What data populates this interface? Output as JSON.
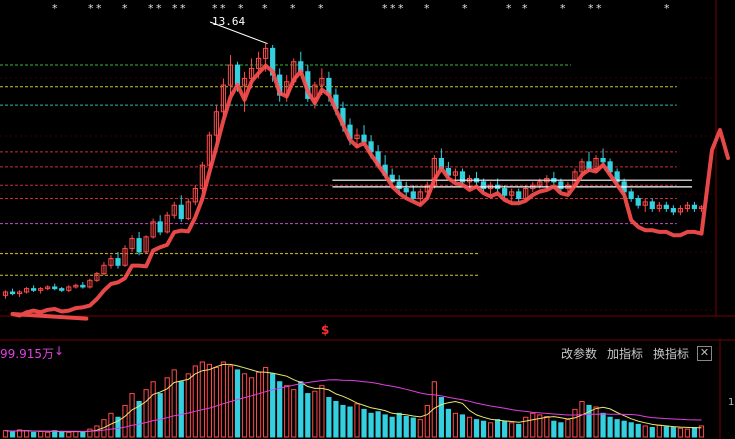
{
  "chart_data": {
    "type": "candlestick",
    "peak_label": "13.64",
    "price_range": [
      5.6,
      14.5
    ],
    "candles": [
      [
        6.1,
        6.25,
        6.0,
        6.2
      ],
      [
        6.2,
        6.3,
        6.1,
        6.15
      ],
      [
        6.15,
        6.25,
        6.05,
        6.2
      ],
      [
        6.2,
        6.35,
        6.15,
        6.3
      ],
      [
        6.3,
        6.4,
        6.2,
        6.25
      ],
      [
        6.25,
        6.35,
        6.15,
        6.3
      ],
      [
        6.3,
        6.4,
        6.25,
        6.35
      ],
      [
        6.35,
        6.45,
        6.25,
        6.3
      ],
      [
        6.3,
        6.35,
        6.2,
        6.25
      ],
      [
        6.25,
        6.4,
        6.2,
        6.35
      ],
      [
        6.35,
        6.45,
        6.3,
        6.4
      ],
      [
        6.4,
        6.5,
        6.3,
        6.35
      ],
      [
        6.35,
        6.6,
        6.3,
        6.55
      ],
      [
        6.55,
        6.8,
        6.5,
        6.75
      ],
      [
        6.75,
        7.1,
        6.7,
        7.0
      ],
      [
        7.0,
        7.3,
        6.9,
        7.2
      ],
      [
        7.2,
        7.4,
        6.9,
        7.0
      ],
      [
        7.0,
        7.6,
        6.95,
        7.5
      ],
      [
        7.5,
        7.9,
        7.4,
        7.8
      ],
      [
        7.8,
        8.0,
        7.3,
        7.4
      ],
      [
        7.4,
        7.9,
        7.35,
        7.85
      ],
      [
        7.85,
        8.4,
        7.8,
        8.3
      ],
      [
        8.3,
        8.5,
        7.9,
        8.0
      ],
      [
        8.0,
        8.6,
        7.95,
        8.5
      ],
      [
        8.5,
        8.9,
        8.4,
        8.8
      ],
      [
        8.8,
        9.1,
        8.3,
        8.4
      ],
      [
        8.4,
        9.0,
        8.35,
        8.9
      ],
      [
        8.9,
        9.4,
        8.8,
        9.3
      ],
      [
        9.3,
        10.1,
        9.2,
        10.0
      ],
      [
        10.0,
        11.0,
        9.9,
        10.9
      ],
      [
        10.9,
        11.8,
        10.6,
        11.6
      ],
      [
        11.6,
        12.6,
        11.4,
        12.4
      ],
      [
        12.4,
        13.3,
        12.1,
        13.0
      ],
      [
        13.0,
        13.1,
        12.2,
        12.4
      ],
      [
        12.4,
        12.8,
        11.6,
        12.6
      ],
      [
        12.6,
        13.2,
        12.3,
        12.9
      ],
      [
        12.9,
        13.4,
        12.6,
        13.2
      ],
      [
        13.2,
        13.64,
        12.8,
        13.5
      ],
      [
        13.5,
        13.6,
        12.5,
        12.7
      ],
      [
        12.7,
        12.9,
        11.9,
        12.1
      ],
      [
        12.1,
        12.7,
        11.9,
        12.5
      ],
      [
        12.5,
        13.2,
        12.4,
        13.1
      ],
      [
        13.1,
        13.4,
        12.7,
        12.8
      ],
      [
        12.8,
        13.0,
        11.9,
        12.0
      ],
      [
        12.0,
        12.5,
        11.7,
        12.4
      ],
      [
        12.4,
        12.9,
        12.1,
        12.6
      ],
      [
        12.6,
        12.8,
        11.9,
        12.1
      ],
      [
        12.1,
        12.3,
        11.5,
        11.7
      ],
      [
        11.7,
        11.9,
        11.0,
        11.2
      ],
      [
        11.2,
        11.4,
        10.6,
        10.8
      ],
      [
        10.8,
        11.1,
        10.5,
        10.9
      ],
      [
        10.9,
        11.2,
        10.6,
        10.7
      ],
      [
        10.7,
        10.9,
        10.2,
        10.4
      ],
      [
        10.4,
        10.6,
        9.9,
        10.0
      ],
      [
        10.0,
        10.3,
        9.6,
        9.7
      ],
      [
        9.7,
        9.9,
        9.3,
        9.5
      ],
      [
        9.5,
        9.7,
        9.1,
        9.3
      ],
      [
        9.3,
        9.5,
        9.0,
        9.2
      ],
      [
        9.2,
        9.4,
        8.9,
        9.0
      ],
      [
        9.0,
        9.3,
        8.8,
        9.2
      ],
      [
        9.2,
        9.5,
        9.0,
        9.4
      ],
      [
        9.4,
        10.3,
        9.3,
        10.2
      ],
      [
        10.2,
        10.5,
        9.8,
        9.9
      ],
      [
        9.9,
        10.1,
        9.6,
        9.7
      ],
      [
        9.7,
        9.9,
        9.5,
        9.8
      ],
      [
        9.8,
        9.9,
        9.4,
        9.5
      ],
      [
        9.5,
        9.7,
        9.3,
        9.6
      ],
      [
        9.6,
        9.8,
        9.4,
        9.5
      ],
      [
        9.5,
        9.6,
        9.2,
        9.3
      ],
      [
        9.3,
        9.5,
        9.1,
        9.4
      ],
      [
        9.4,
        9.6,
        9.2,
        9.3
      ],
      [
        9.3,
        9.4,
        9.0,
        9.1
      ],
      [
        9.1,
        9.3,
        8.9,
        9.2
      ],
      [
        9.2,
        9.3,
        8.9,
        9.0
      ],
      [
        9.0,
        9.4,
        8.95,
        9.3
      ],
      [
        9.3,
        9.5,
        9.2,
        9.4
      ],
      [
        9.4,
        9.6,
        9.3,
        9.5
      ],
      [
        9.5,
        9.7,
        9.3,
        9.6
      ],
      [
        9.6,
        9.8,
        9.4,
        9.5
      ],
      [
        9.5,
        9.6,
        9.2,
        9.3
      ],
      [
        9.3,
        9.5,
        9.2,
        9.4
      ],
      [
        9.4,
        9.9,
        9.35,
        9.8
      ],
      [
        9.8,
        10.2,
        9.7,
        10.1
      ],
      [
        10.1,
        10.4,
        9.8,
        9.9
      ],
      [
        9.9,
        10.3,
        9.8,
        10.2
      ],
      [
        10.2,
        10.5,
        10.0,
        10.1
      ],
      [
        10.1,
        10.2,
        9.7,
        9.8
      ],
      [
        9.8,
        9.9,
        9.4,
        9.5
      ],
      [
        9.5,
        9.6,
        9.1,
        9.2
      ],
      [
        9.2,
        9.3,
        8.9,
        9.0
      ],
      [
        9.0,
        9.1,
        8.7,
        8.8
      ],
      [
        8.8,
        9.0,
        8.6,
        8.9
      ],
      [
        8.9,
        9.0,
        8.6,
        8.7
      ],
      [
        8.7,
        8.9,
        8.6,
        8.8
      ],
      [
        8.8,
        8.9,
        8.6,
        8.7
      ],
      [
        8.7,
        8.8,
        8.5,
        8.6
      ],
      [
        8.6,
        8.8,
        8.5,
        8.7
      ],
      [
        8.7,
        8.9,
        8.6,
        8.8
      ],
      [
        8.8,
        8.9,
        8.6,
        8.7
      ],
      [
        8.7,
        8.8,
        8.6,
        8.75
      ]
    ],
    "levels": [
      {
        "price": 13.0,
        "color": "#3cb43c",
        "end": 0.81
      },
      {
        "price": 12.35,
        "color": "#c8c832",
        "end": 0.96
      },
      {
        "price": 11.8,
        "color": "#32b4b4",
        "end": 0.96
      },
      {
        "price": 10.4,
        "color": "#c83232",
        "end": 0.96
      },
      {
        "price": 9.95,
        "color": "#c83232",
        "end": 0.96
      },
      {
        "price": 9.4,
        "color": "#c83232",
        "end": 0.96
      },
      {
        "price": 9.0,
        "color": "#c83232",
        "end": 0.96
      },
      {
        "price": 8.25,
        "color": "#c84bc8",
        "end": 0.96
      },
      {
        "price": 7.35,
        "color": "#c8c832",
        "end": 0.68
      },
      {
        "price": 6.7,
        "color": "#c8c832",
        "end": 0.68
      }
    ],
    "volume": [
      8,
      7,
      9,
      8,
      6,
      7,
      6,
      8,
      7,
      6,
      7,
      6,
      10,
      14,
      22,
      30,
      25,
      40,
      55,
      45,
      60,
      70,
      55,
      75,
      85,
      70,
      80,
      90,
      95,
      92,
      88,
      95,
      90,
      85,
      80,
      75,
      82,
      88,
      80,
      70,
      65,
      60,
      70,
      55,
      58,
      65,
      50,
      45,
      40,
      38,
      42,
      35,
      30,
      32,
      28,
      25,
      30,
      26,
      24,
      22,
      40,
      70,
      50,
      35,
      30,
      28,
      25,
      22,
      20,
      18,
      22,
      20,
      18,
      16,
      25,
      30,
      28,
      26,
      20,
      18,
      22,
      35,
      45,
      40,
      38,
      30,
      25,
      22,
      20,
      18,
      16,
      14,
      12,
      15,
      13,
      12,
      11,
      10,
      12,
      14
    ],
    "volume_value": "99.915万",
    "volume_arrow": "↓",
    "volume_scale": "1",
    "markers_top": "*",
    "signal": "$"
  },
  "toolbar": {
    "modify_params": "改参数",
    "add_indicator": "加指标",
    "switch_indicator": "换指标",
    "close": "✕"
  }
}
